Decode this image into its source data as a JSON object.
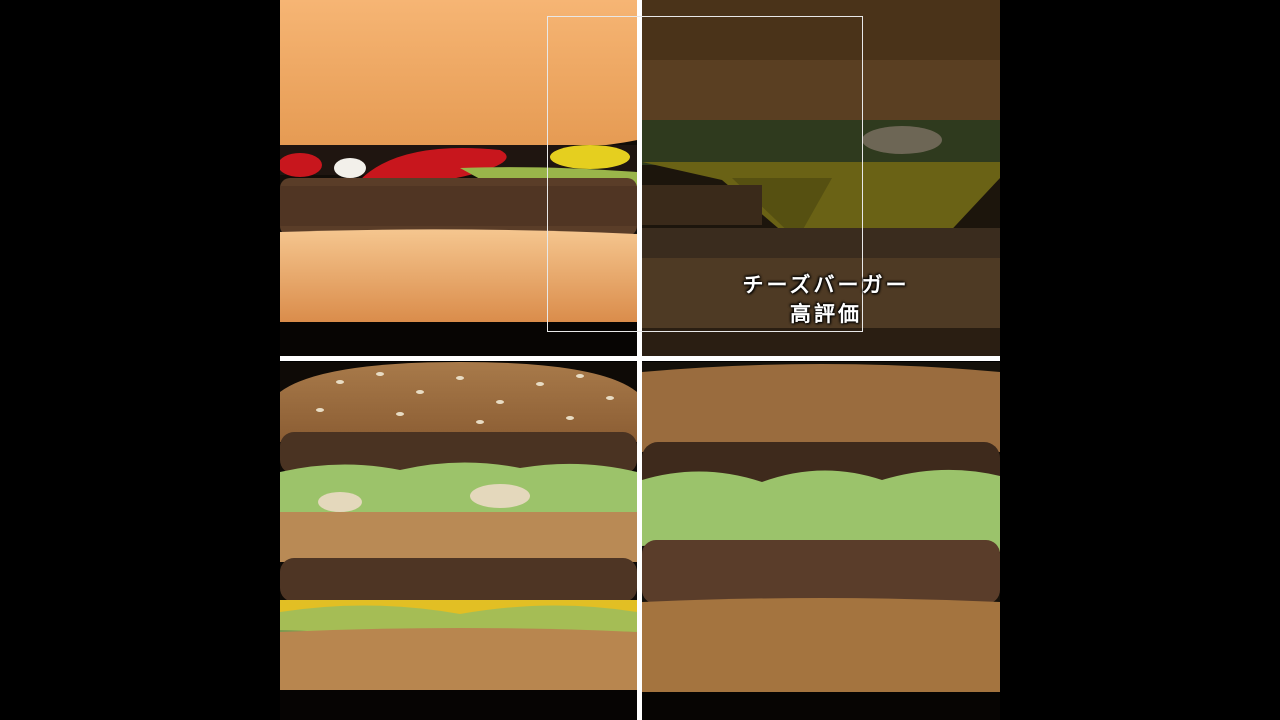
{
  "caption": {
    "line1": "チーズバーガー",
    "line2": "高評価"
  },
  "panels": [
    {
      "subject": "hamburger"
    },
    {
      "subject": "cheeseburger"
    },
    {
      "subject": "big-mac"
    },
    {
      "subject": "double-patty-burger"
    }
  ],
  "colors": {
    "background": "#000000",
    "divider": "#ffffff",
    "bun": "#e9a25c",
    "patty": "#5a3d28",
    "lettuce": "#9fc86a",
    "cheese": "#e8c52a",
    "ketchup": "#c8161d"
  }
}
